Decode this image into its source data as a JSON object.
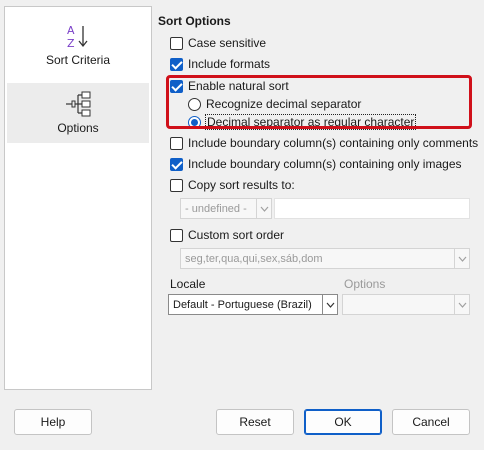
{
  "sidebar": {
    "items": [
      {
        "label": "Sort Criteria",
        "icon": "sort-az-icon",
        "selected": false
      },
      {
        "label": "Options",
        "icon": "tree-options-icon",
        "selected": true
      }
    ]
  },
  "options": {
    "section_title": "Sort Options",
    "case_sensitive": {
      "label": "Case sensitive",
      "checked": false
    },
    "include_formats": {
      "label": "Include formats",
      "checked": true
    },
    "natural_sort": {
      "label": "Enable natural sort",
      "checked": true
    },
    "recognize_decimal": {
      "label": "Recognize decimal separator",
      "selected": false
    },
    "decimal_regular": {
      "label": "Decimal separator as regular character",
      "selected": true
    },
    "boundary_comments": {
      "label": "Include boundary column(s) containing only comments",
      "checked": false
    },
    "boundary_images": {
      "label": "Include boundary column(s) containing only images",
      "checked": true
    },
    "copy_results": {
      "label": "Copy sort results to:",
      "checked": false
    },
    "copy_target": {
      "value": "- undefined -",
      "text": ""
    },
    "custom_order": {
      "label": "Custom sort order",
      "checked": false
    },
    "custom_list": {
      "value": "seg,ter,qua,qui,sex,sáb,dom"
    },
    "locale": {
      "label": "Locale",
      "value": "Default - Portuguese (Brazil)"
    },
    "locale_options": {
      "label": "Options",
      "value": ""
    }
  },
  "buttons": {
    "help": "Help",
    "reset": "Reset",
    "ok": "OK",
    "cancel": "Cancel"
  },
  "colors": {
    "accent": "#0f5fc8",
    "highlight": "#d0101a"
  }
}
